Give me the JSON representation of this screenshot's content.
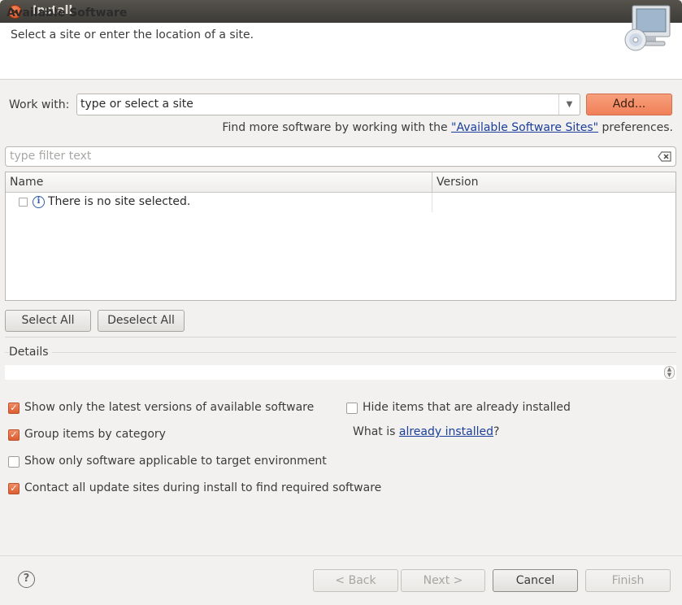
{
  "window": {
    "title": "Install"
  },
  "header": {
    "title": "Available Software",
    "description": "Select a site or enter the location of a site.",
    "icon": "monitor-cd-icon"
  },
  "work_with": {
    "label": "Work with:",
    "value": "type or select a site",
    "add_label": "Add...",
    "find_more_prefix": "Find more software by working with the ",
    "find_more_link": "\"Available Software Sites\"",
    "find_more_suffix": " preferences."
  },
  "filter": {
    "placeholder": "type filter text"
  },
  "table": {
    "columns": [
      "Name",
      "Version"
    ],
    "rows": [
      {
        "name": "There is no site selected.",
        "version": ""
      }
    ]
  },
  "buttons": {
    "select_all": "Select All",
    "deselect_all": "Deselect All"
  },
  "details": {
    "label": "Details"
  },
  "options": {
    "latest_versions": {
      "label": "Show only the latest versions of available software",
      "checked": true
    },
    "group_by_category": {
      "label": "Group items by category",
      "checked": true
    },
    "target_env": {
      "label": "Show only software applicable to target environment",
      "checked": false
    },
    "contact_sites": {
      "label": "Contact all update sites during install to find required software",
      "checked": true
    },
    "hide_installed": {
      "label": "Hide items that are already installed",
      "checked": false
    },
    "what_is_prefix": "What is ",
    "what_is_link": "already installed",
    "what_is_suffix": "?"
  },
  "footer": {
    "back": "< Back",
    "next": "Next >",
    "cancel": "Cancel",
    "finish": "Finish"
  },
  "colors": {
    "accent": "#f08059",
    "link": "#1a3e9a"
  }
}
